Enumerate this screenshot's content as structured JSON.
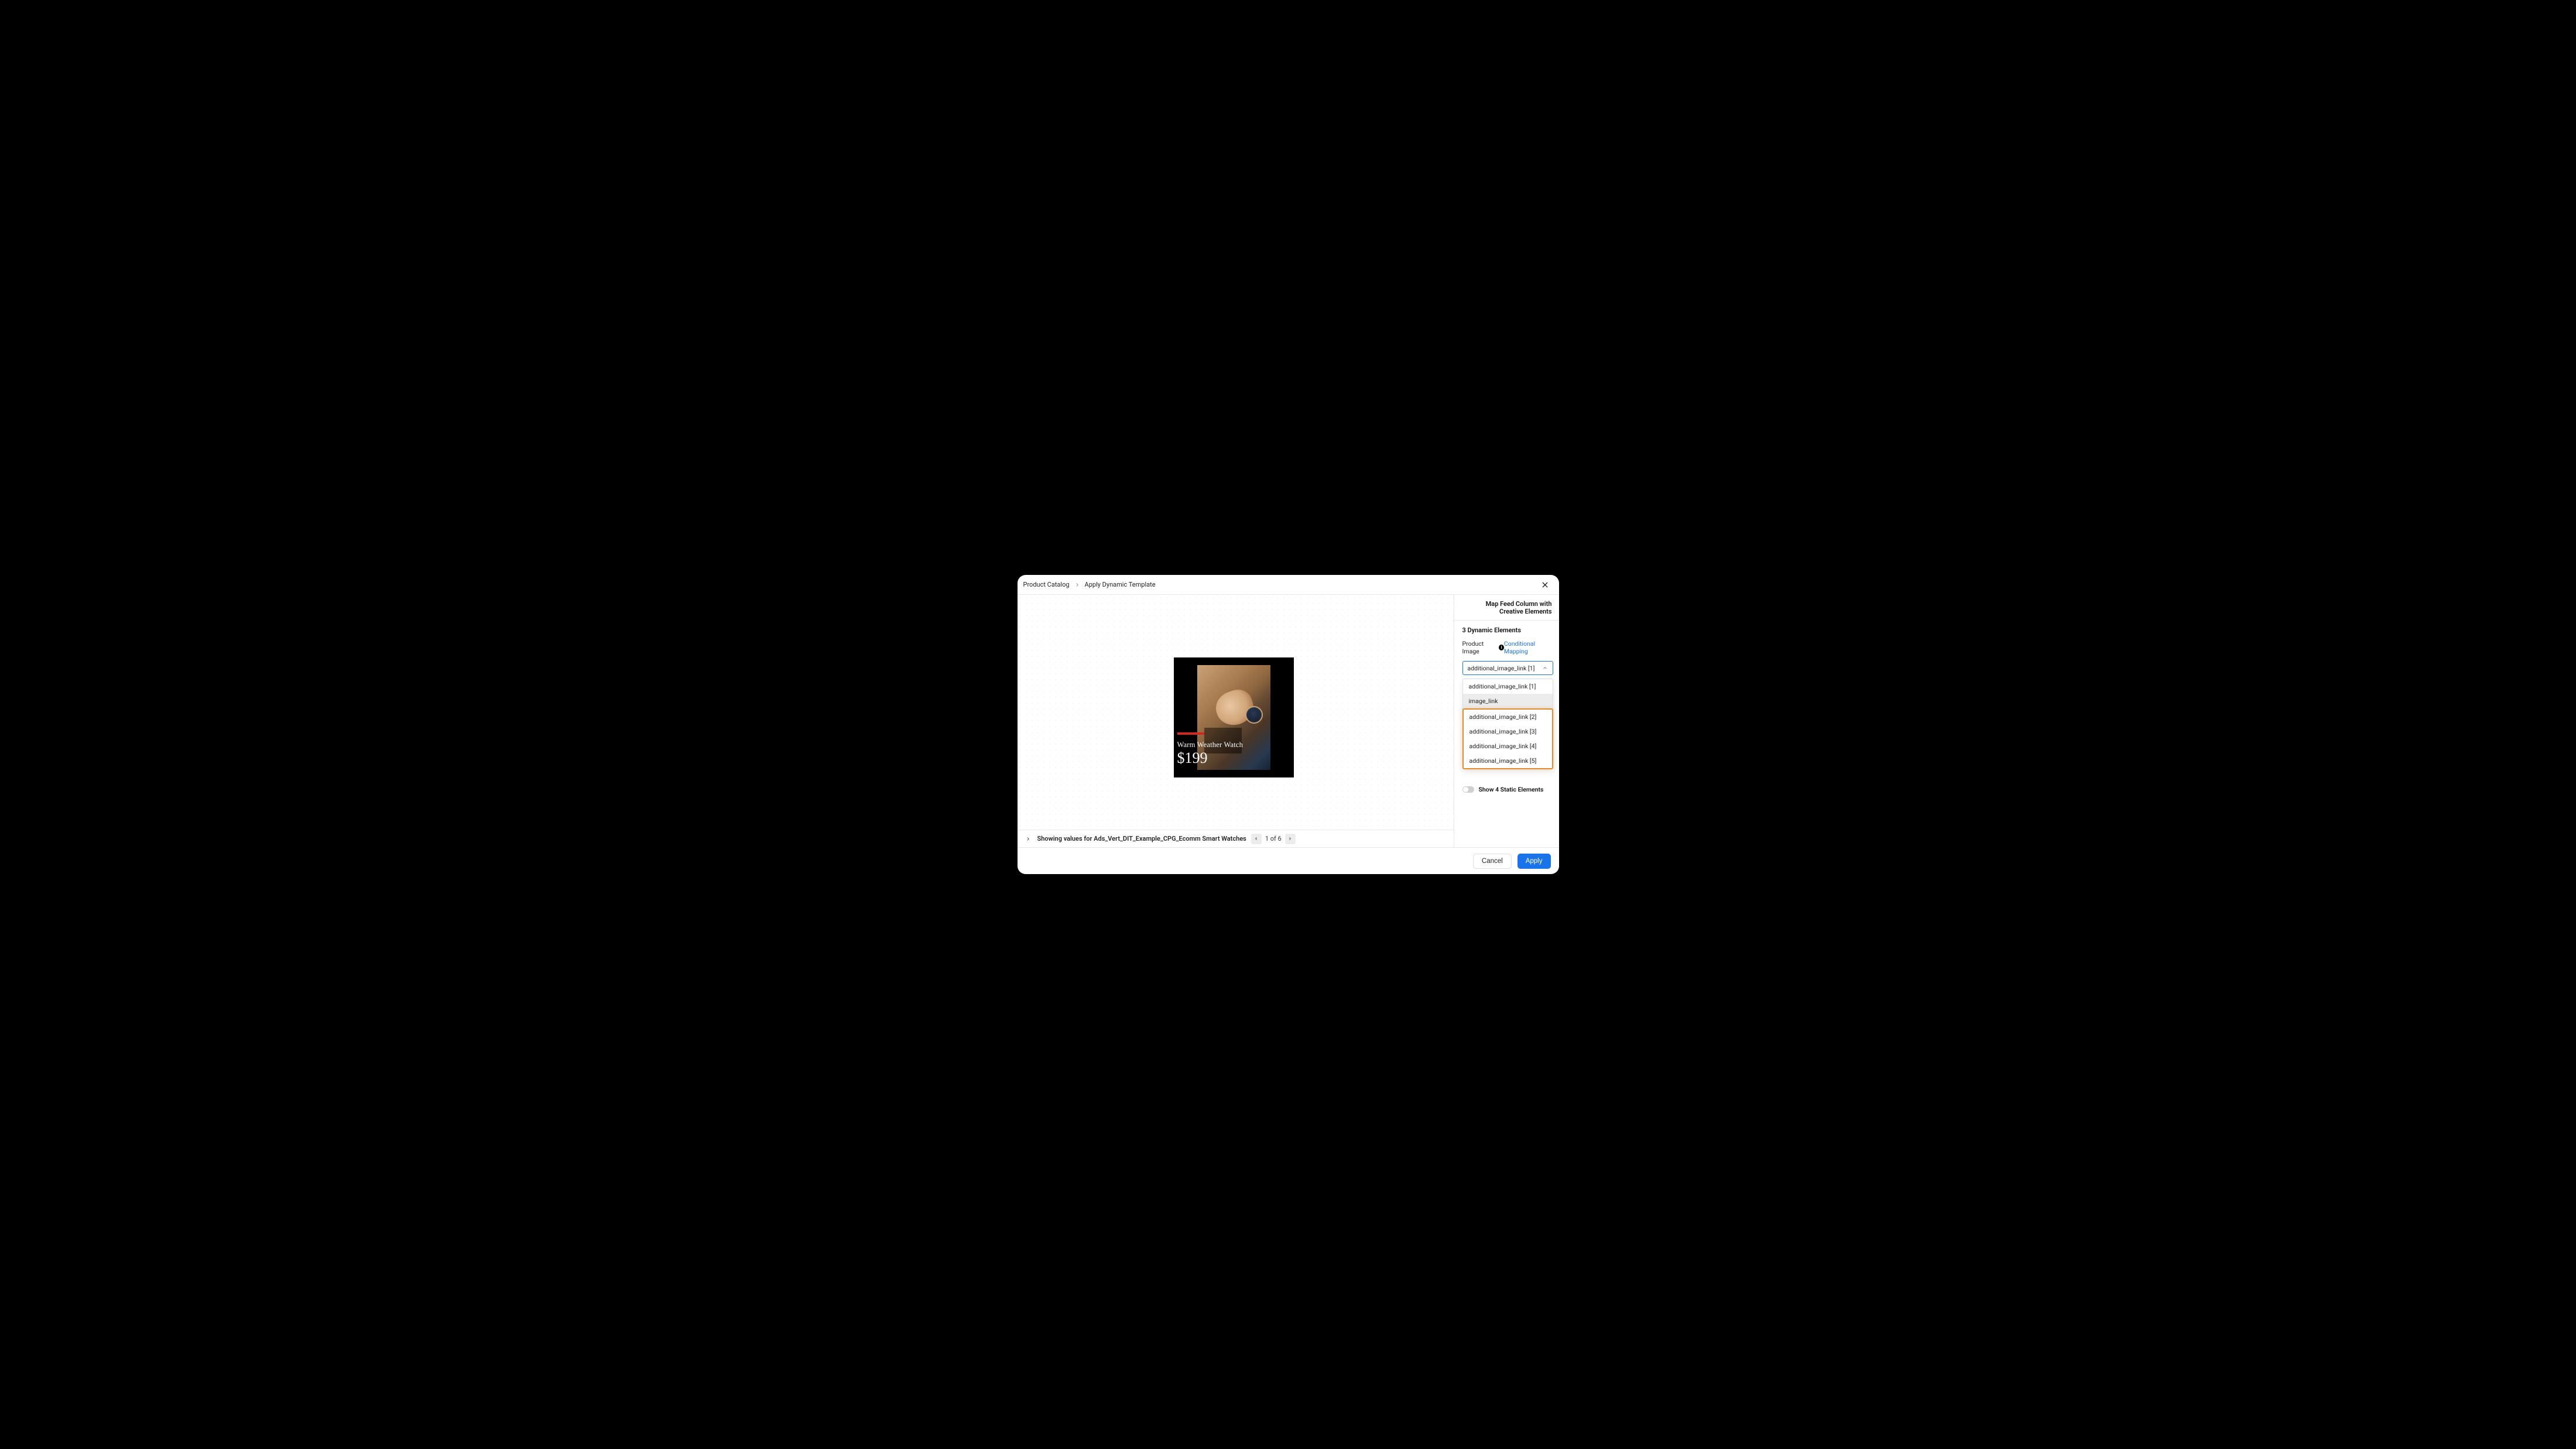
{
  "breadcrumb": {
    "root": "Product Catalog",
    "current": "Apply Dynamic Template"
  },
  "canvas": {
    "product_title": "Warm Weather Watch",
    "product_price": "$199"
  },
  "canvas_footer": {
    "showing_label": "Showing values for Ads_Vert_DIT_Example_CPG_Ecomm Smart Watches",
    "pager_label": "1 of 6"
  },
  "sidebar": {
    "header": "Map Feed Column with Creative Elements",
    "dynamic_count_label": "3 Dynamic Elements",
    "field_label": "Product Image",
    "conditional_link": "Conditional Mapping",
    "select_value": "additional_image_link [1]",
    "options_top": [
      "additional_image_link [1]",
      "image_link"
    ],
    "options_highlighted": [
      "additional_image_link [2]",
      "additional_image_link [3]",
      "additional_image_link [4]",
      "additional_image_link [5]"
    ],
    "toggle_label": "Show 4 Static Elements"
  },
  "footer": {
    "cancel": "Cancel",
    "apply": "Apply"
  }
}
